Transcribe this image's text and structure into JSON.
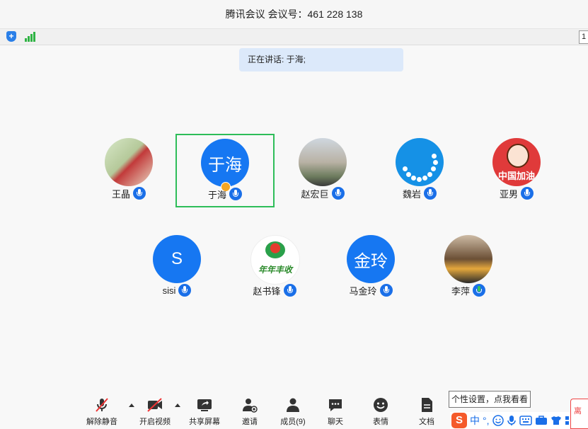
{
  "window": {
    "title": "腾讯会议 会议号：461 228 138"
  },
  "infobar": {
    "page_label": "1"
  },
  "speaking": {
    "text": "正在讲话: 于海;"
  },
  "participants": [
    {
      "name": "王晶",
      "avatar_text": "",
      "mic": "blue",
      "active": false
    },
    {
      "name": "于海",
      "avatar_text": "于海",
      "mic": "blue",
      "active": true,
      "host": true
    },
    {
      "name": "赵宏巨",
      "avatar_text": "",
      "mic": "blue",
      "active": false
    },
    {
      "name": "魏岩",
      "avatar_text": "",
      "mic": "blue",
      "active": false
    },
    {
      "name": "亚男",
      "avatar_text": "中国加油",
      "mic": "blue",
      "active": false
    },
    {
      "name": "sisi",
      "avatar_text": "S",
      "mic": "blue",
      "active": false
    },
    {
      "name": "赵书锋",
      "avatar_text": "年年丰收",
      "mic": "blue",
      "active": false
    },
    {
      "name": "马金玲",
      "avatar_text": "金玲",
      "mic": "blue",
      "active": false
    },
    {
      "name": "李萍",
      "avatar_text": "",
      "mic": "green",
      "active": false
    }
  ],
  "toolbar": {
    "unmute": "解除静音",
    "video": "开启视频",
    "share": "共享屏幕",
    "invite": "邀请",
    "members": "成员(9)",
    "chat": "聊天",
    "reactions": "表情",
    "docs": "文档"
  },
  "tooltip": {
    "text": "个性设置，点我看看"
  },
  "ime": {
    "logo": "S",
    "lang": "中",
    "punct": "°,"
  },
  "right_edge": {
    "text": "离"
  },
  "colors": {
    "accent": "#1677f2",
    "active_border": "#2ebd59",
    "speaking_bg": "#dce9fa"
  }
}
